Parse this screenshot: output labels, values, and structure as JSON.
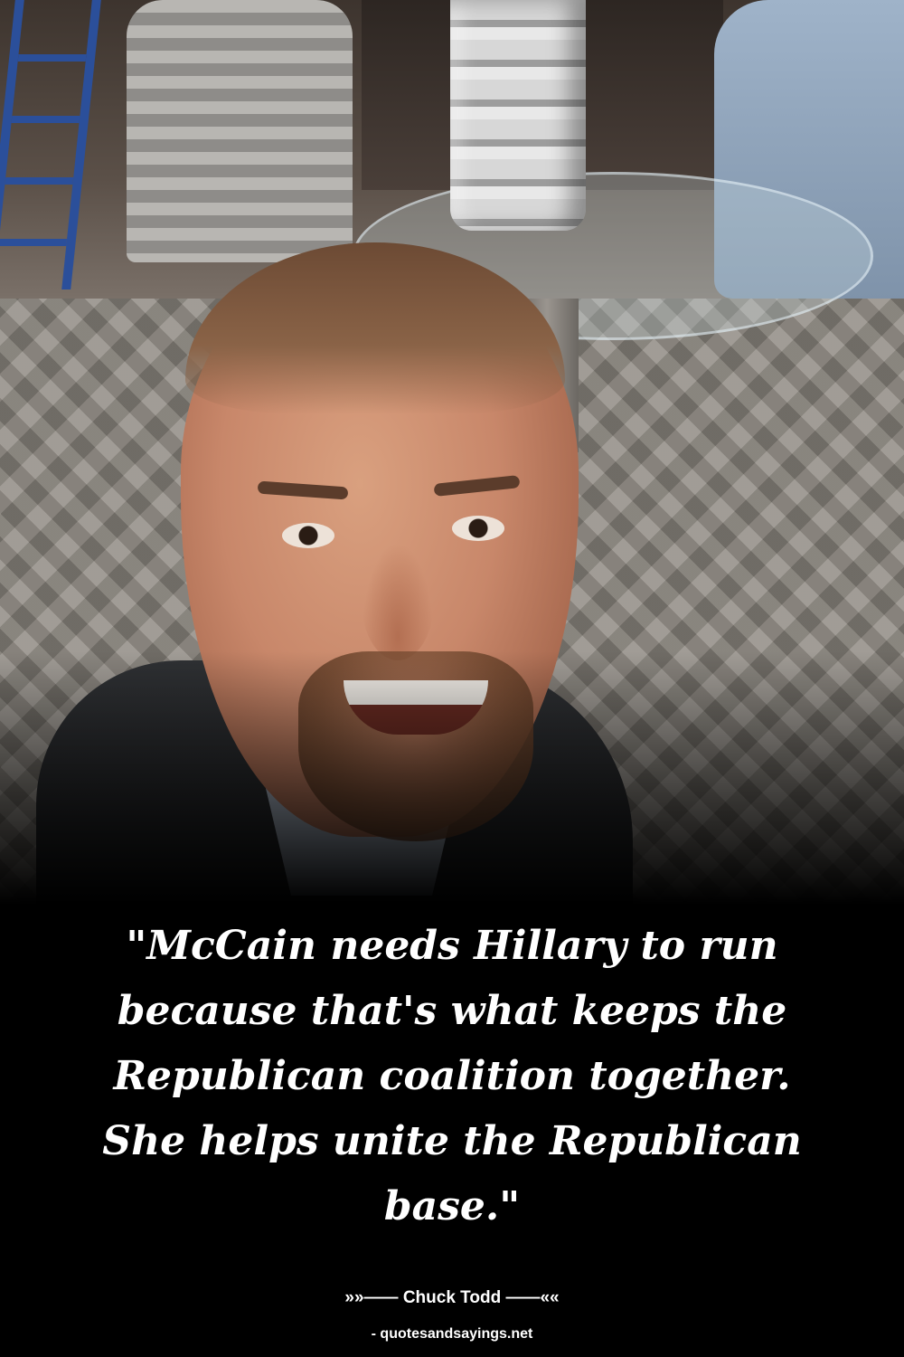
{
  "quote": {
    "text": "\"McCain needs Hillary to run because that's what keeps the Republican coalition together. She helps unite the Republican base.\""
  },
  "attribution": {
    "author_line": "»»—— Chuck Todd ——««",
    "source": "- quotesandsayings.net"
  },
  "colors": {
    "background": "#000000",
    "text": "#ffffff"
  }
}
